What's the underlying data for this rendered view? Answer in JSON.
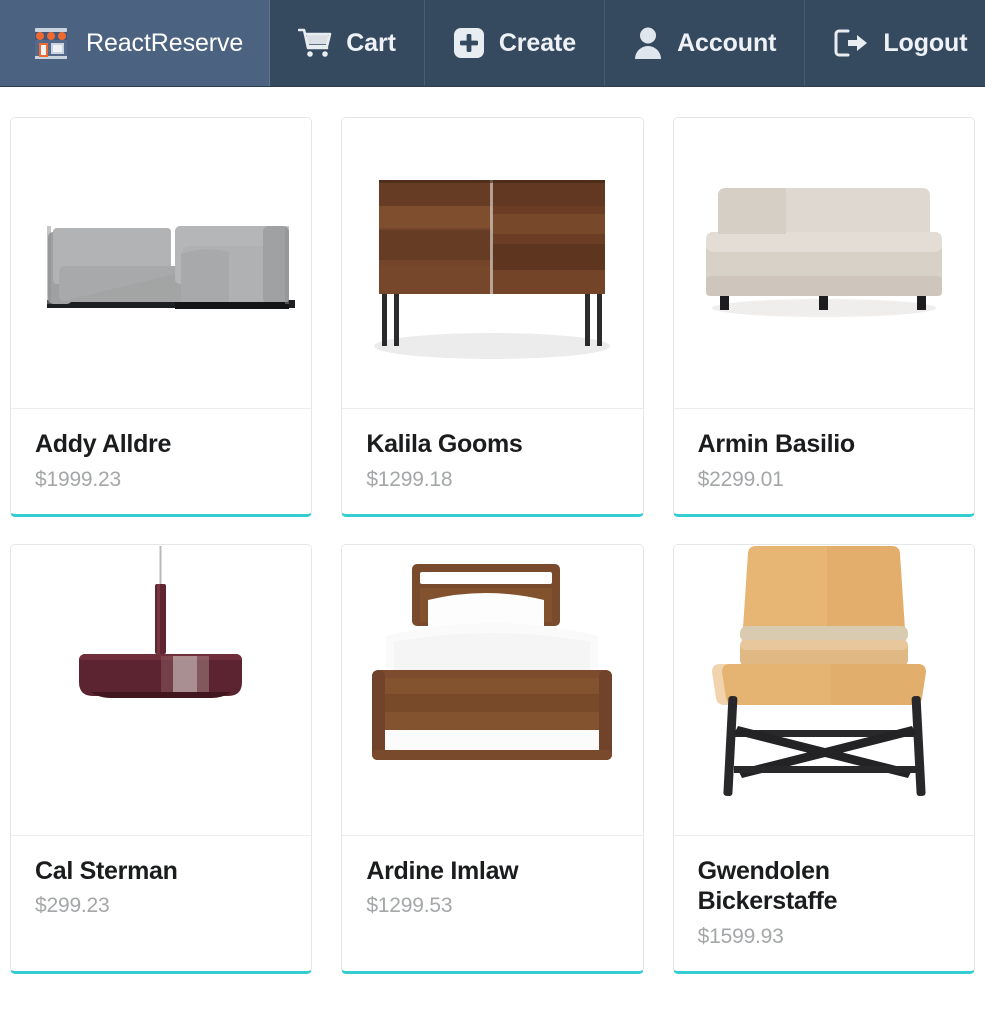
{
  "theme": {
    "navbar_bg": "#35495f",
    "navbar_active_bg": "#4b6280",
    "card_accent": "#35ccd2",
    "title_color": "#1b1c1d",
    "price_color": "#a4a6a8",
    "page_bg": "#ffffff"
  },
  "navbar": {
    "brand": {
      "label": "ReactReserve",
      "icon": "storefront-icon"
    },
    "items": [
      {
        "label": "Cart",
        "icon": "shopping-cart-icon"
      },
      {
        "label": "Create",
        "icon": "plus-square-icon"
      },
      {
        "label": "Account",
        "icon": "user-icon"
      },
      {
        "label": "Logout",
        "icon": "sign-out-icon"
      }
    ]
  },
  "products": [
    {
      "name": "Addy Alldre",
      "price": "$1999.23",
      "image": "gray-sectional-sofa"
    },
    {
      "name": "Kalila Gooms",
      "price": "$1299.18",
      "image": "walnut-credenza"
    },
    {
      "name": "Armin Basilio",
      "price": "$2299.01",
      "image": "cream-armless-sofa"
    },
    {
      "name": "Cal Sterman",
      "price": "$299.23",
      "image": "maroon-pendant-lamp"
    },
    {
      "name": "Ardine Imlaw",
      "price": "$1299.53",
      "image": "walnut-bed"
    },
    {
      "name": "Gwendolen Bickerstaffe",
      "price": "$1599.93",
      "image": "tan-leather-chair"
    }
  ]
}
